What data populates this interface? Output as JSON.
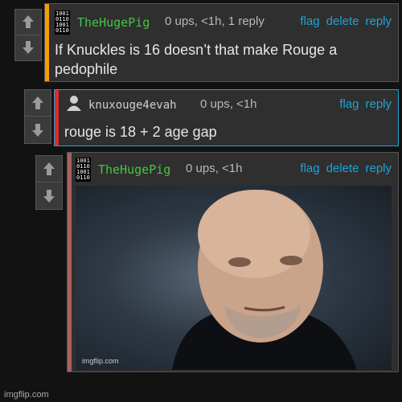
{
  "comments": [
    {
      "username": "TheHugePig",
      "meta": "0 ups, <1h, 1 reply",
      "actions": [
        "flag",
        "delete",
        "reply"
      ],
      "text": "If Knuckles is 16 doesn’t that make Rouge a pedophile",
      "avatar_icon": "binary-avatar-icon",
      "stripe_color": "#f0a000"
    },
    {
      "username": "knuxouge4evah",
      "meta": "0 ups, <1h",
      "actions": [
        "flag",
        "reply"
      ],
      "text": "rouge is 18 + 2 age gap",
      "avatar_icon": "default-user-avatar-icon",
      "stripe_color": "#e2282d"
    },
    {
      "username": "TheHugePig",
      "meta": "0 ups, <1h",
      "actions": [
        "flag",
        "delete",
        "reply"
      ],
      "image_watermark": "imgflip.com",
      "avatar_icon": "binary-avatar-icon",
      "stripe_color": "#a86060"
    }
  ],
  "site_watermark": "imgflip.com",
  "colors": {
    "link": "#1ea3d6",
    "username_green": "#45c545",
    "background": "#121212"
  }
}
